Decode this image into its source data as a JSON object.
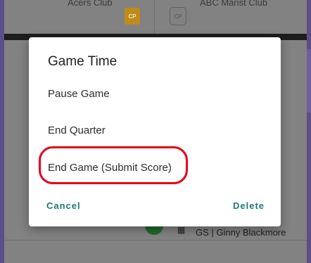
{
  "background": {
    "team_left": "Acers Club",
    "team_right": "ABC Marist Club",
    "badge_left": "CP",
    "badge_right": "CP",
    "bottom_player": "GS | Ginny Blackmore"
  },
  "dialog": {
    "title": "Game Time",
    "options": [
      {
        "label": "Pause Game"
      },
      {
        "label": "End Quarter"
      },
      {
        "label": "End Game (Submit Score)"
      }
    ],
    "cancel_label": "Cancel",
    "delete_label": "Delete"
  },
  "colors": {
    "accent": "#1d7a75",
    "highlight": "#e4001a",
    "badge": "#c08a1c"
  }
}
